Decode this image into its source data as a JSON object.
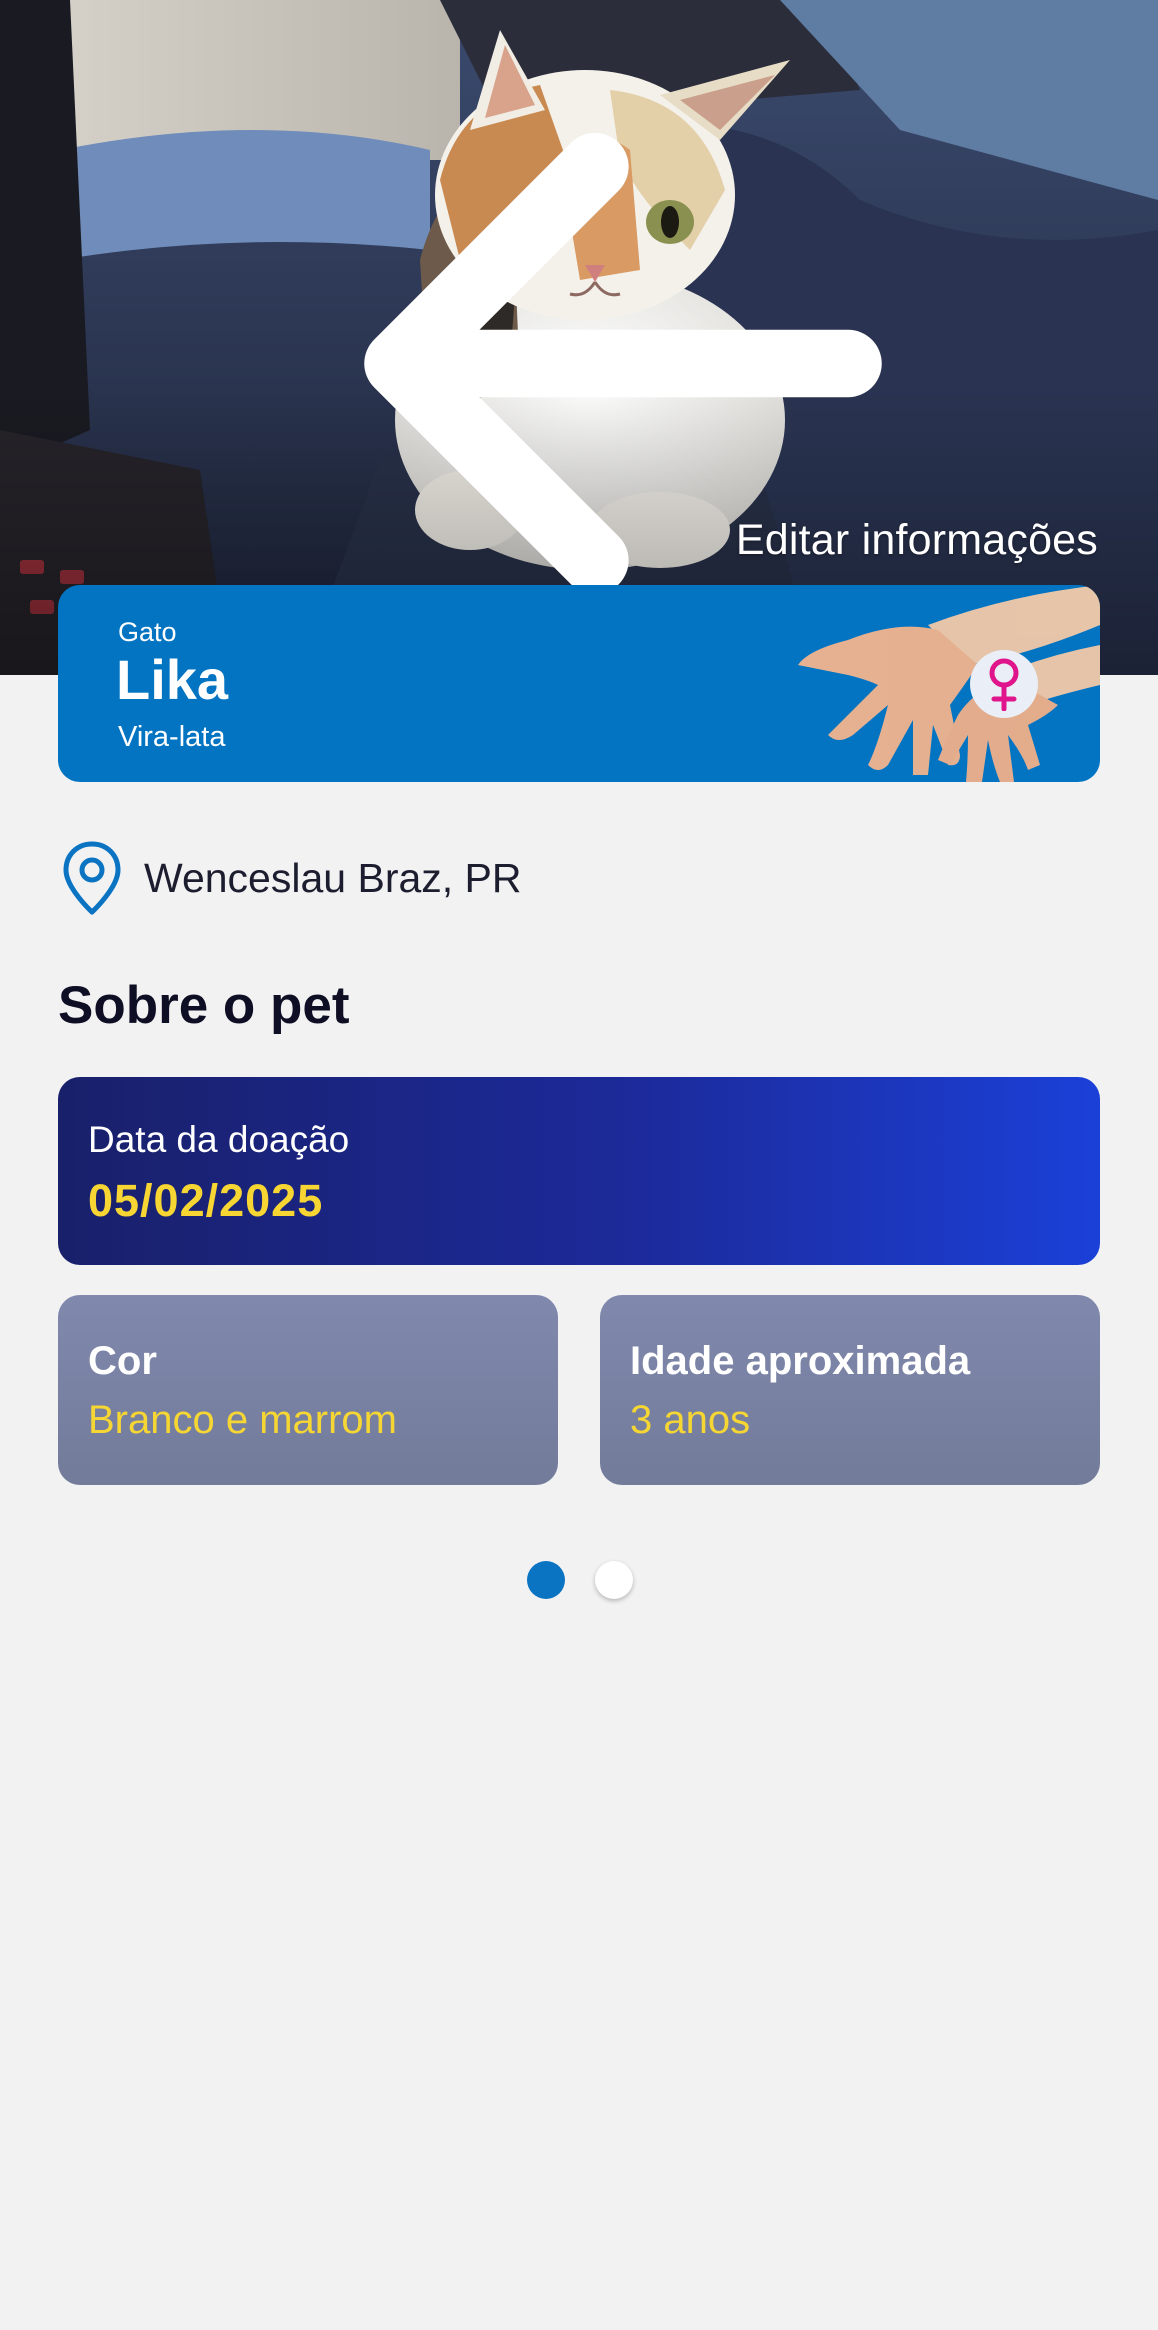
{
  "header": {
    "back_icon": "arrow-left-icon",
    "notifications_icon": "bell-icon",
    "menu_icon": "hamburger-menu-icon",
    "edit_label": "Editar informações"
  },
  "pet": {
    "species": "Gato",
    "name": "Lika",
    "breed": "Vira-lata",
    "sex_icon": "female-symbol-icon",
    "card_color": "#0274c2",
    "sex_color": "#e0158c"
  },
  "location": {
    "icon": "location-pin-icon",
    "text": "Wenceslau Braz, PR"
  },
  "about": {
    "title": "Sobre o pet",
    "donation": {
      "label": "Data da doação",
      "value": "05/02/2025"
    },
    "color": {
      "label": "Cor",
      "value": "Branco e marrom"
    },
    "age": {
      "label": "Idade aproximada",
      "value": "3 anos"
    },
    "value_color": "#f7d633"
  },
  "pager": {
    "total": 2,
    "active": 1,
    "active_color": "#0a73c2"
  }
}
